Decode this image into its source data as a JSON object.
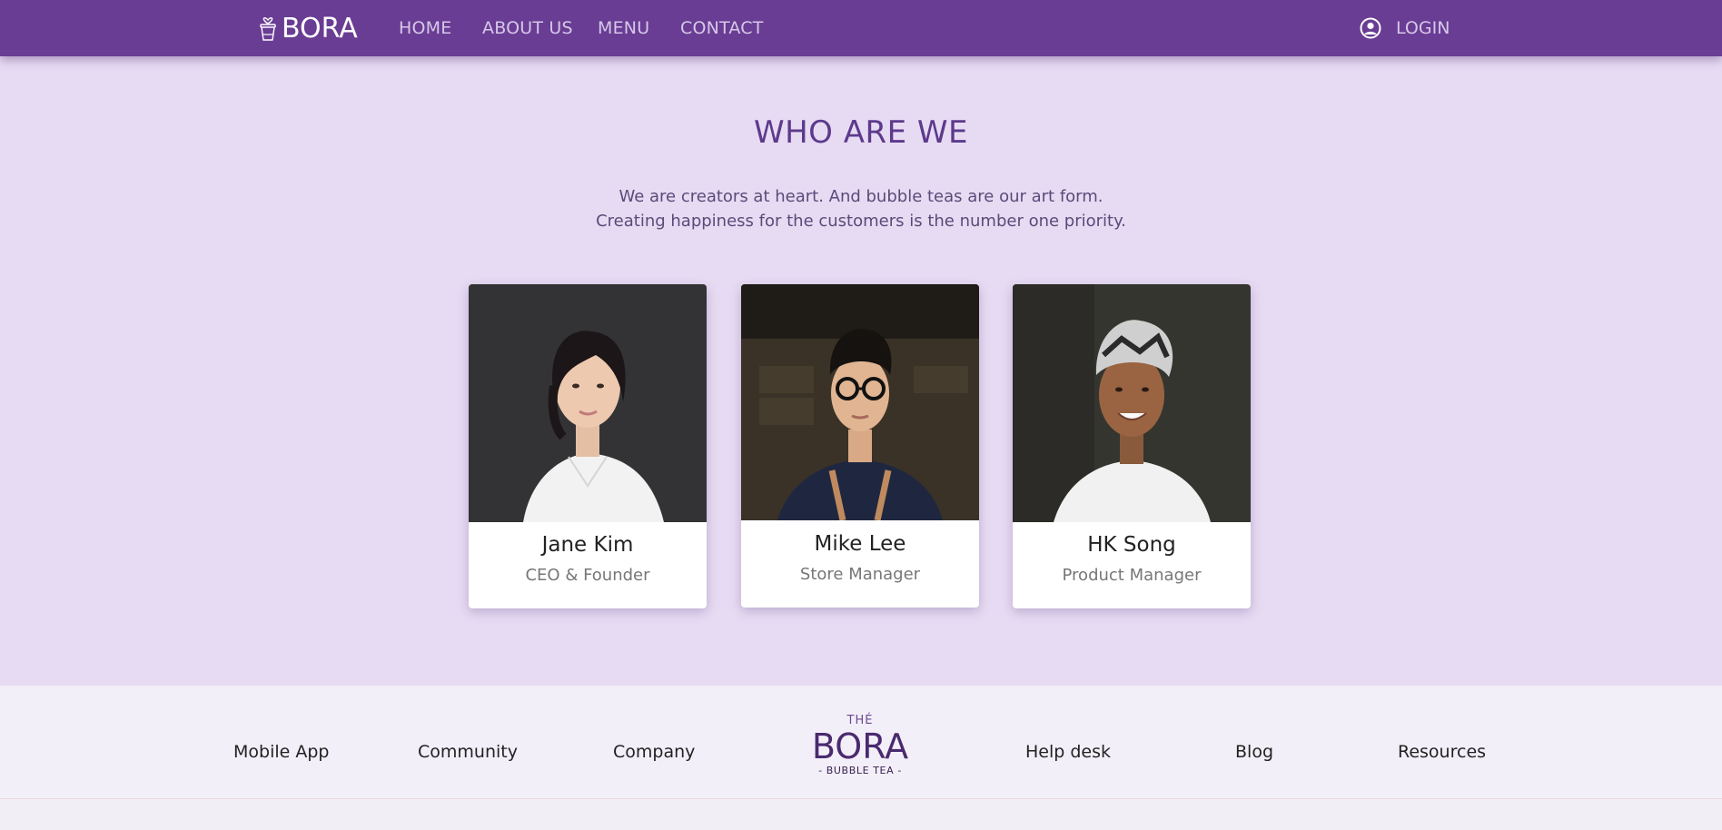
{
  "header": {
    "brand": "BORA",
    "nav": [
      "HOME",
      "ABOUT US",
      "MENU",
      "CONTACT"
    ],
    "login_label": "LOGIN"
  },
  "about": {
    "title": "WHO ARE WE",
    "line1": "We are creators at heart. And bubble teas are our art form.",
    "line2": "Creating happiness for the customers is the number one priority.",
    "team": [
      {
        "name": "Jane Kim",
        "role": "CEO & Founder"
      },
      {
        "name": "Mike Lee",
        "role": "Store Manager"
      },
      {
        "name": "HK Song",
        "role": "Product Manager"
      }
    ]
  },
  "footer": {
    "links_left": [
      "Mobile App",
      "Community",
      "Company"
    ],
    "links_right": [
      "Help desk",
      "Blog",
      "Resources"
    ],
    "logo_top": "THÉ",
    "logo_word": "BORA",
    "logo_sub": "- BUBBLE TEA -"
  },
  "colors": {
    "header_bg": "#6a3d94",
    "section_bg": "#e7dbf3",
    "title_purple": "#5d3a8c",
    "footer_bg": "#f3eff9"
  },
  "icons": {
    "brand": "bubble-tea-cup-icon",
    "login": "user-circle-icon"
  }
}
